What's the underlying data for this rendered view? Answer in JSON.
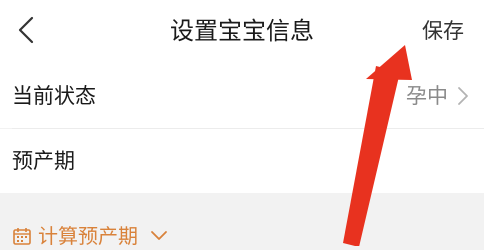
{
  "header": {
    "title": "设置宝宝信息",
    "save_label": "保存",
    "back_icon": "chevron-left-icon"
  },
  "rows": [
    {
      "label": "当前状态",
      "value": "孕中"
    },
    {
      "label": "预产期",
      "value": ""
    }
  ],
  "calc": {
    "label": "计算预产期",
    "icon": "calendar-icon"
  },
  "colors": {
    "accent": "#d9823a",
    "annotation_arrow": "#e8321f"
  }
}
